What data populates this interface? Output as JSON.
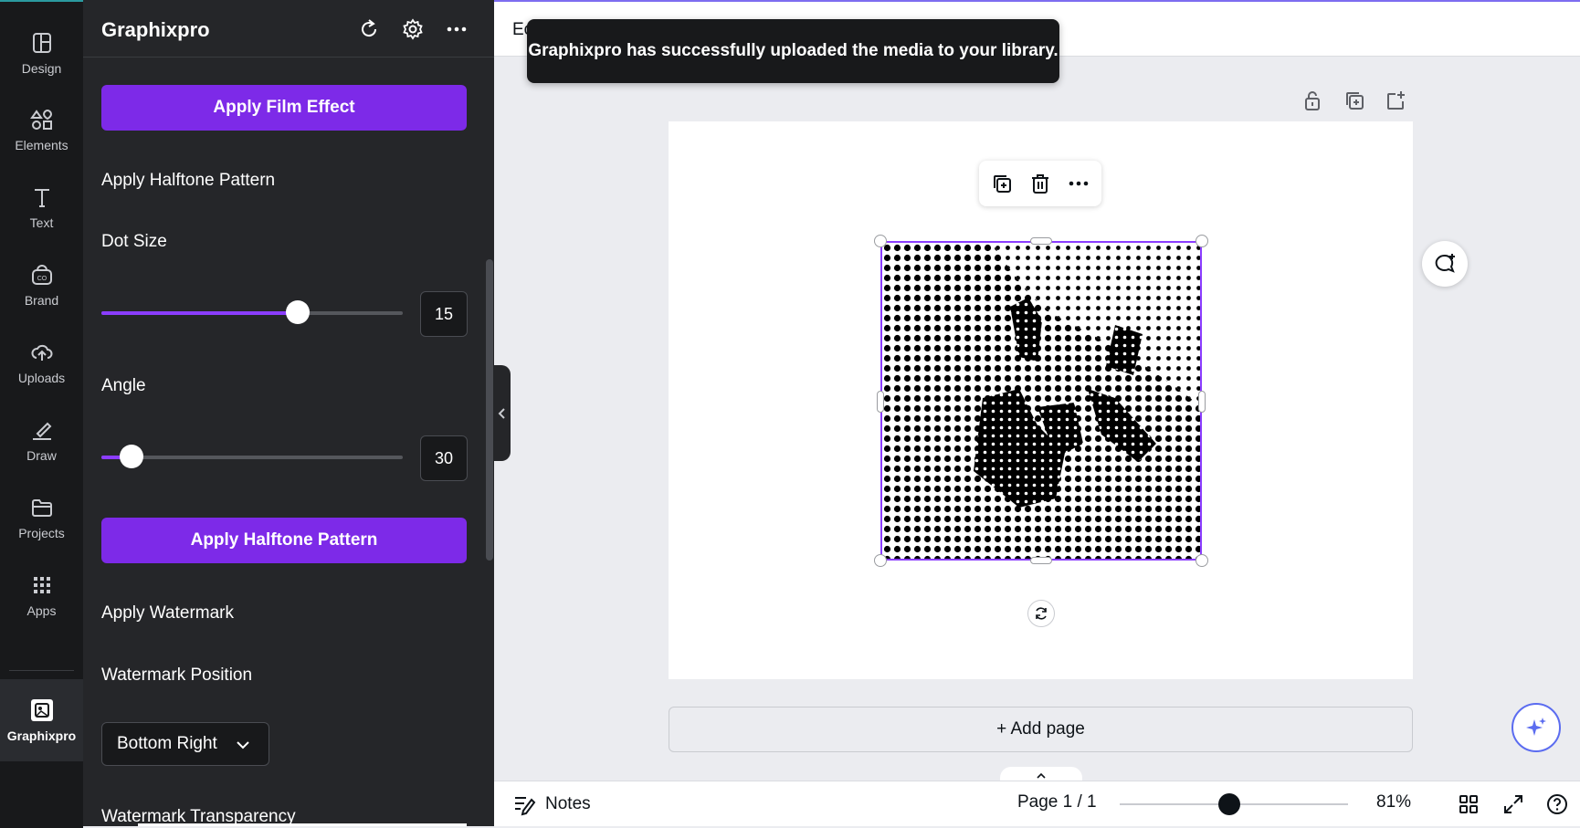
{
  "rail": {
    "items": [
      {
        "label": "Design",
        "icon": "design-icon"
      },
      {
        "label": "Elements",
        "icon": "elements-icon"
      },
      {
        "label": "Text",
        "icon": "text-icon"
      },
      {
        "label": "Brand",
        "icon": "brand-icon"
      },
      {
        "label": "Uploads",
        "icon": "uploads-icon"
      },
      {
        "label": "Draw",
        "icon": "draw-icon"
      },
      {
        "label": "Projects",
        "icon": "projects-icon"
      },
      {
        "label": "Apps",
        "icon": "apps-icon"
      }
    ],
    "active": {
      "label": "Graphixpro",
      "icon": "graphixpro-app-icon"
    }
  },
  "panel": {
    "title": "Graphixpro",
    "apply_film_label": "Apply Film Effect",
    "halftone_heading": "Apply Halftone Pattern",
    "dot_size_label": "Dot Size",
    "dot_size_value": "15",
    "dot_size_fraction": 0.65,
    "angle_label": "Angle",
    "angle_value": "30",
    "angle_fraction": 0.1,
    "apply_halftone_label": "Apply Halftone Pattern",
    "watermark_heading": "Apply Watermark",
    "watermark_position_label": "Watermark Position",
    "watermark_position_value": "Bottom Right",
    "watermark_transparency_label": "Watermark Transparency"
  },
  "topbar": {
    "partial_text": "Ec"
  },
  "toast": {
    "message": "Graphixpro has successfully uploaded the media to your library."
  },
  "canvas": {
    "add_page_label": "+ Add page"
  },
  "bottombar": {
    "notes_label": "Notes",
    "page_indicator": "Page 1 / 1",
    "zoom_label": "81%",
    "zoom_fraction": 0.48
  },
  "colors": {
    "accent": "#7d2ae8",
    "rail_bg": "#18191b",
    "panel_bg": "#252629",
    "selection": "#8b3dff"
  }
}
